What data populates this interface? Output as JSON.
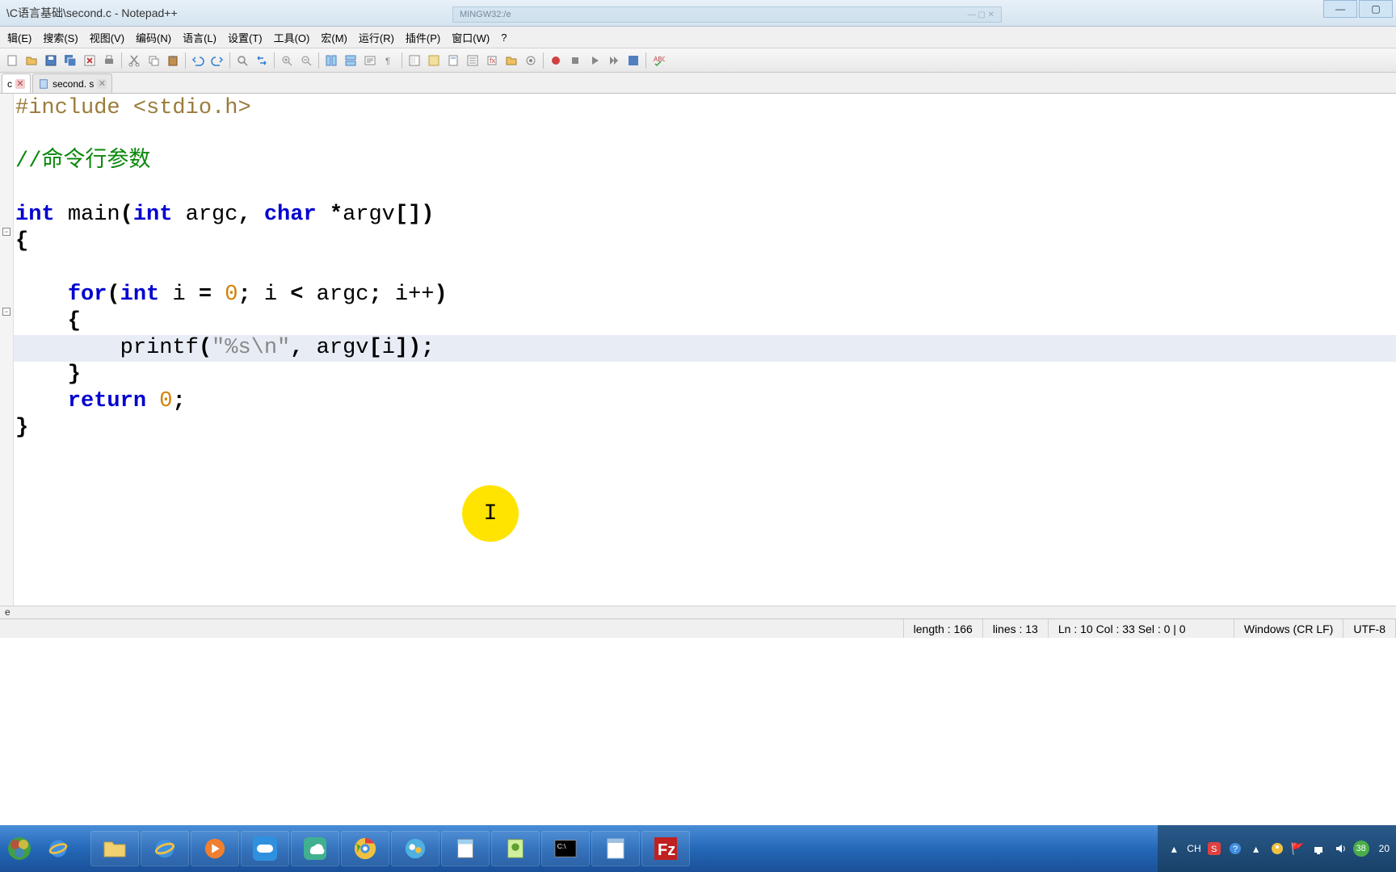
{
  "window": {
    "title": "\\C语言基础\\second.c - Notepad++",
    "phantom_title": "MINGW32:/e"
  },
  "menu": {
    "items": [
      "辑(E)",
      "搜索(S)",
      "视图(V)",
      "编码(N)",
      "语言(L)",
      "设置(T)",
      "工具(O)",
      "宏(M)",
      "运行(R)",
      "插件(P)",
      "窗口(W)",
      "?"
    ]
  },
  "tabs": [
    {
      "label": "c",
      "active": true
    },
    {
      "label": "second. s",
      "active": false
    }
  ],
  "code": {
    "lines": [
      {
        "type": "preproc",
        "text": "#include <stdio.h>"
      },
      {
        "type": "blank",
        "text": ""
      },
      {
        "type": "comment",
        "text": "//命令行参数"
      },
      {
        "type": "blank",
        "text": ""
      },
      {
        "type": "funcdecl",
        "parts": {
          "kw_int1": "int",
          "main": "main",
          "kw_int2": "int",
          "argc": "argc",
          "kw_char": "char",
          "argv": "argv"
        }
      },
      {
        "type": "brace",
        "text": "{"
      },
      {
        "type": "blank",
        "text": ""
      },
      {
        "type": "for",
        "parts": {
          "kw_for": "for",
          "kw_int": "int",
          "i": "i",
          "zero": "0",
          "argc": "argc",
          "ipp": "i++"
        }
      },
      {
        "type": "brace_indent",
        "text": "    {"
      },
      {
        "type": "printf",
        "indent": "        ",
        "parts": {
          "printf": "printf",
          "fmt": "\"%s\\n\"",
          "argv": "argv",
          "i": "i"
        }
      },
      {
        "type": "brace_indent",
        "text": "    }"
      },
      {
        "type": "return",
        "indent": "    ",
        "parts": {
          "kw_return": "return",
          "zero": "0"
        }
      },
      {
        "type": "brace",
        "text": "}"
      }
    ]
  },
  "status": {
    "path_tail": "e",
    "length": "length : 166",
    "lines": "lines : 13",
    "pos": "Ln : 10    Col : 33    Sel : 0 | 0",
    "eol": "Windows (CR LF)",
    "encoding": "UTF-8"
  },
  "taskbar": {
    "lang": "CH",
    "date_tail": "20",
    "badge": "38"
  }
}
